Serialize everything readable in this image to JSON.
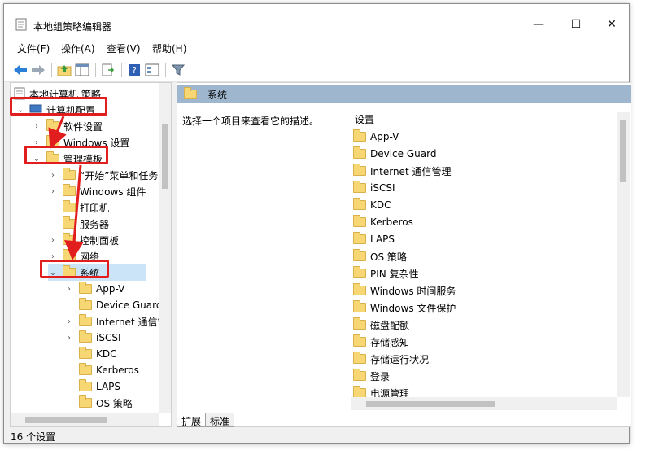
{
  "window": {
    "title": "本地组策略编辑器",
    "controls": {
      "minimize": "—",
      "maximize": "☐",
      "close": "✕"
    }
  },
  "menu": [
    "文件(F)",
    "操作(A)",
    "查看(V)",
    "帮助(H)"
  ],
  "toolbar": [
    "back-icon",
    "forward-icon",
    "up-folder-icon",
    "show-tree-icon",
    "export-list-icon",
    "help-icon",
    "properties-icon",
    "filter-icon"
  ],
  "tree": {
    "root": "本地计算机 策略",
    "items": [
      {
        "label": "计算机配置",
        "icon": "computer-icon",
        "expanded": true
      },
      {
        "label": "软件设置",
        "chevron": ">"
      },
      {
        "label": "Windows 设置",
        "chevron": ">"
      },
      {
        "label": "管理模板",
        "chevron": "v"
      },
      {
        "label": "“开始”菜单和任务栏",
        "chevron": ">"
      },
      {
        "label": "Windows 组件",
        "chevron": ">"
      },
      {
        "label": "打印机",
        "chevron": ""
      },
      {
        "label": "服务器",
        "chevron": ""
      },
      {
        "label": "控制面板",
        "chevron": ">"
      },
      {
        "label": "网络",
        "chevron": ">"
      },
      {
        "label": "系统",
        "chevron": "v"
      },
      {
        "label": "App-V",
        "chevron": ">"
      },
      {
        "label": "Device Guard",
        "chevron": ""
      },
      {
        "label": "Internet 通信管理",
        "chevron": ">"
      },
      {
        "label": "iSCSI",
        "chevron": ">"
      },
      {
        "label": "KDC",
        "chevron": ""
      },
      {
        "label": "Kerberos",
        "chevron": ""
      },
      {
        "label": "LAPS",
        "chevron": ""
      },
      {
        "label": "OS 策略",
        "chevron": ""
      }
    ]
  },
  "right": {
    "header": "系统",
    "description": "选择一个项目来查看它的描述。",
    "column": "设置",
    "items": [
      "App-V",
      "Device Guard",
      "Internet 通信管理",
      "iSCSI",
      "KDC",
      "Kerberos",
      "LAPS",
      "OS 策略",
      "PIN 复杂性",
      "Windows 时间服务",
      "Windows 文件保护",
      "磁盘配额",
      "存储感知",
      "存储运行状况",
      "登录",
      "电源管理"
    ]
  },
  "tabs": [
    "扩展",
    "标准"
  ],
  "status": "16 个设置",
  "colors": {
    "highlight": "#e11d1d",
    "header": "#9eb6ce",
    "folder": "#f7d674"
  }
}
